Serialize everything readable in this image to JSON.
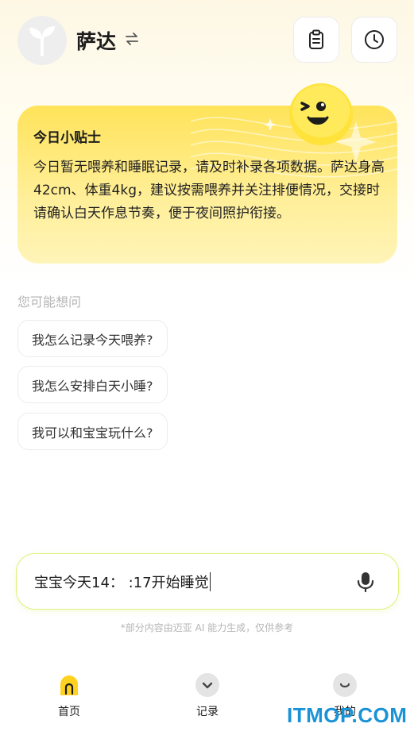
{
  "header": {
    "baby_name": "萨达",
    "swap_icon": "swap-arrows-icon",
    "clipboard_icon": "clipboard-icon",
    "history_icon": "clock-icon"
  },
  "tip_card": {
    "title": "今日小贴士",
    "body": "今日暂无喂养和睡眠记录，请及时补录各项数据。萨达身高42cm、体重4kg，建议按需喂养并关注排便情况，交接时请确认白天作息节奏，便于夜间照护衔接。",
    "accent_color": "#ffe35a"
  },
  "suggestions": {
    "label": "您可能想问",
    "items": [
      "我怎么记录今天喂养?",
      "我怎么安排白天小睡?",
      "我可以和宝宝玩什么?"
    ]
  },
  "input": {
    "value": "宝宝今天14： :17开始睡觉",
    "mic_icon": "microphone-icon"
  },
  "disclaimer": "*部分内容由迈亚 AI 能力生成，仅供参考",
  "tabs": [
    {
      "label": "首页",
      "icon": "home-icon",
      "active": true
    },
    {
      "label": "记录",
      "icon": "chevron-down-icon",
      "active": false
    },
    {
      "label": "我的",
      "icon": "smile-icon",
      "active": false
    }
  ],
  "watermark": "ITMOP.COM"
}
